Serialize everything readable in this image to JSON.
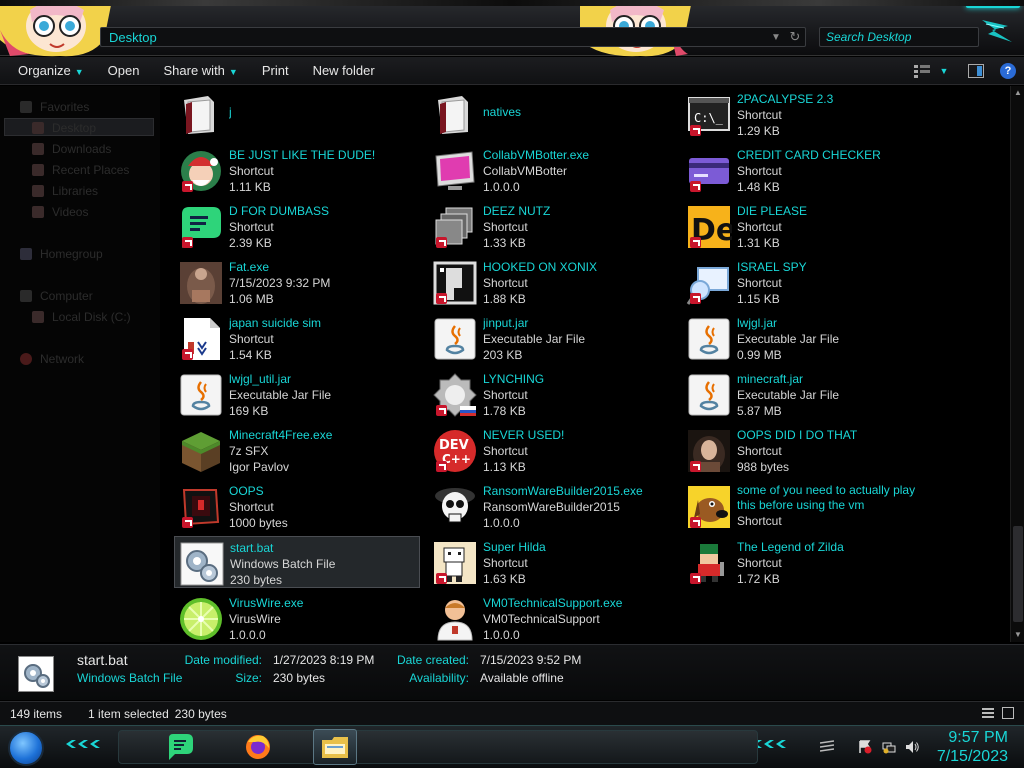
{
  "window": {
    "breadcrumb": "Desktop",
    "search_placeholder": "Search Desktop"
  },
  "toolbar": {
    "organize": "Organize",
    "open": "Open",
    "share_with": "Share with",
    "print": "Print",
    "new_folder": "New folder"
  },
  "nav": {
    "items": [
      "Favorites",
      "Desktop",
      "Downloads",
      "Recent Places",
      "Libraries",
      "Videos",
      "Homegroup",
      "Computer",
      "Local Disk (C:)",
      "Network"
    ]
  },
  "files": [
    {
      "name": "j",
      "line2": "",
      "line3": "",
      "icon": "folder-icon"
    },
    {
      "name": "natives",
      "line2": "",
      "line3": "",
      "icon": "folder-icon"
    },
    {
      "name": "2PACALYPSE 2.3",
      "line2": "Shortcut",
      "line3": "1.29 KB",
      "icon": "terminal-icon"
    },
    {
      "name": "BE JUST LIKE THE DUDE!",
      "line2": "Shortcut",
      "line3": "1.11 KB",
      "icon": "santa-icon"
    },
    {
      "name": "CollabVMBotter.exe",
      "line2": "CollabVMBotter",
      "line3": "1.0.0.0",
      "icon": "monitor-icon"
    },
    {
      "name": "CREDIT CARD CHECKER",
      "line2": "Shortcut",
      "line3": "1.48 KB",
      "icon": "credit-card-icon"
    },
    {
      "name": "D FOR DUMBASS",
      "line2": "Shortcut",
      "line3": "2.39 KB",
      "icon": "chat-bubble-icon"
    },
    {
      "name": "DEEZ NUTZ",
      "line2": "Shortcut",
      "line3": "1.33 KB",
      "icon": "stacked-windows-icon"
    },
    {
      "name": "DIE PLEASE",
      "line2": "Shortcut",
      "line3": "1.31 KB",
      "icon": "de-logo-icon"
    },
    {
      "name": "Fat.exe",
      "line2": "7/15/2023 9:32 PM",
      "line3": "1.06 MB",
      "icon": "photo-icon"
    },
    {
      "name": "HOOKED ON XONIX",
      "line2": "Shortcut",
      "line3": "1.88 KB",
      "icon": "xonix-icon"
    },
    {
      "name": "ISRAEL SPY",
      "line2": "Shortcut",
      "line3": "1.15 KB",
      "icon": "magnifier-monitor-icon"
    },
    {
      "name": "japan suicide sim",
      "line2": "Shortcut",
      "line3": "1.54 KB",
      "icon": "document-icon"
    },
    {
      "name": "jinput.jar",
      "line2": "Executable Jar File",
      "line3": "203 KB",
      "icon": "java-icon"
    },
    {
      "name": "lwjgl.jar",
      "line2": "Executable Jar File",
      "line3": "0.99 MB",
      "icon": "java-icon"
    },
    {
      "name": "lwjgl_util.jar",
      "line2": "Executable Jar File",
      "line3": "169 KB",
      "icon": "java-icon"
    },
    {
      "name": "LYNCHING",
      "line2": "Shortcut",
      "line3": "1.78 KB",
      "icon": "emblem-icon"
    },
    {
      "name": "minecraft.jar",
      "line2": "Executable Jar File",
      "line3": "5.87 MB",
      "icon": "java-icon"
    },
    {
      "name": "Minecraft4Free.exe",
      "line2": "7z SFX",
      "line3": "Igor Pavlov",
      "icon": "grass-block-icon"
    },
    {
      "name": "NEVER USED!",
      "line2": "Shortcut",
      "line3": "1.13 KB",
      "icon": "devcpp-icon"
    },
    {
      "name": "OOPS DID I DO THAT",
      "line2": "Shortcut",
      "line3": "988 bytes",
      "icon": "portrait-icon"
    },
    {
      "name": "OOPS",
      "line2": "Shortcut",
      "line3": "1000 bytes",
      "icon": "red-screen-icon"
    },
    {
      "name": "RansomWareBuilder2015.exe",
      "line2": "RansomWareBuilder2015",
      "line3": "1.0.0.0",
      "icon": "skull-icon"
    },
    {
      "name": "some of you need to actually play this before using the vm",
      "line2": "",
      "line3": "Shortcut",
      "icon": "dog-icon"
    },
    {
      "name": "start.bat",
      "line2": "Windows Batch File",
      "line3": "230 bytes",
      "icon": "gears-icon"
    },
    {
      "name": "Super Hilda",
      "line2": "Shortcut",
      "line3": "1.63 KB",
      "icon": "pixel-character-icon"
    },
    {
      "name": "The Legend of Zilda",
      "line2": "Shortcut",
      "line3": "1.72 KB",
      "icon": "pixel-hero-icon"
    },
    {
      "name": "VirusWire.exe",
      "line2": "VirusWire",
      "line3": "1.0.0.0",
      "icon": "lime-icon"
    },
    {
      "name": "VM0TechnicalSupport.exe",
      "line2": "VM0TechnicalSupport",
      "line3": "1.0.0.0",
      "icon": "support-person-icon"
    }
  ],
  "details": {
    "name": "start.bat",
    "type": "Windows Batch File",
    "date_modified_label": "Date modified:",
    "date_modified": "1/27/2023 8:19 PM",
    "size_label": "Size:",
    "size": "230 bytes",
    "date_created_label": "Date created:",
    "date_created": "7/15/2023 9:52 PM",
    "availability_label": "Availability:",
    "availability": "Available offline"
  },
  "status": {
    "items": "149 items",
    "selected": "1 item selected",
    "selected_size": "230 bytes"
  },
  "taskbar": {
    "time": "9:57 PM",
    "date": "7/15/2023"
  },
  "colors": {
    "accent": "#19d6d6",
    "background": "#000000",
    "text": "#d6d6d6"
  }
}
